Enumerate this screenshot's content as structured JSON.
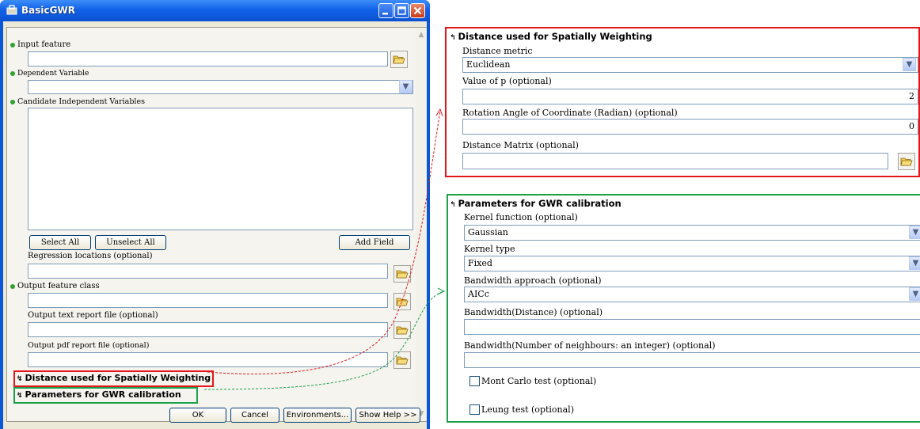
{
  "window": {
    "title": "BasicGWR",
    "buttons": {
      "minimize": "_",
      "maximize": "□",
      "close": "X"
    }
  },
  "form": {
    "input_feature": "Input feature",
    "dependent_variable": "Dependent Variable",
    "candidate_independent": "Candidate Independent Variables",
    "select_all": "Select All",
    "unselect_all": "Unselect All",
    "add_field": "Add Field",
    "regression_locations": "Regression locations (optional)",
    "output_feature_class": "Output feature class",
    "output_text_report": "Output text report file (optional)",
    "output_pdf_report": "Output pdf report file (optional)",
    "section_distance": "Distance used for Spatially Weighting",
    "section_params": "Parameters for GWR calibration"
  },
  "footer": {
    "ok": "OK",
    "cancel": "Cancel",
    "environments": "Environments...",
    "show_help": "Show Help >>"
  },
  "distance_panel": {
    "title": "Distance used for Spatially Weighting",
    "distance_metric_label": "Distance metric",
    "distance_metric_value": "Euclidean",
    "p_label": "Value of p (optional)",
    "p_value": "2",
    "rotation_label": "Rotation Angle of Coordinate (Radian) (optional)",
    "rotation_value": "0",
    "matrix_label": "Distance Matrix (optional)"
  },
  "params_panel": {
    "title": "Parameters for GWR calibration",
    "kernel_function_label": "Kernel function (optional)",
    "kernel_function_value": "Gaussian",
    "kernel_type_label": "Kernel type",
    "kernel_type_value": "Fixed",
    "bandwidth_approach_label": "Bandwidth approach (optional)",
    "bandwidth_approach_value": "AICc",
    "bandwidth_distance_label": "Bandwidth(Distance) (optional)",
    "bandwidth_neighbours_label": "Bandwidth(Number of neighbours: an integer) (optional)",
    "monte_carlo_label": "Mont Carlo test (optional)",
    "leung_label": "Leung test (optional)"
  },
  "colors": {
    "distance_highlight": "#e4161b",
    "params_highlight": "#1aa14a",
    "titlebar": "#0a58d8"
  }
}
